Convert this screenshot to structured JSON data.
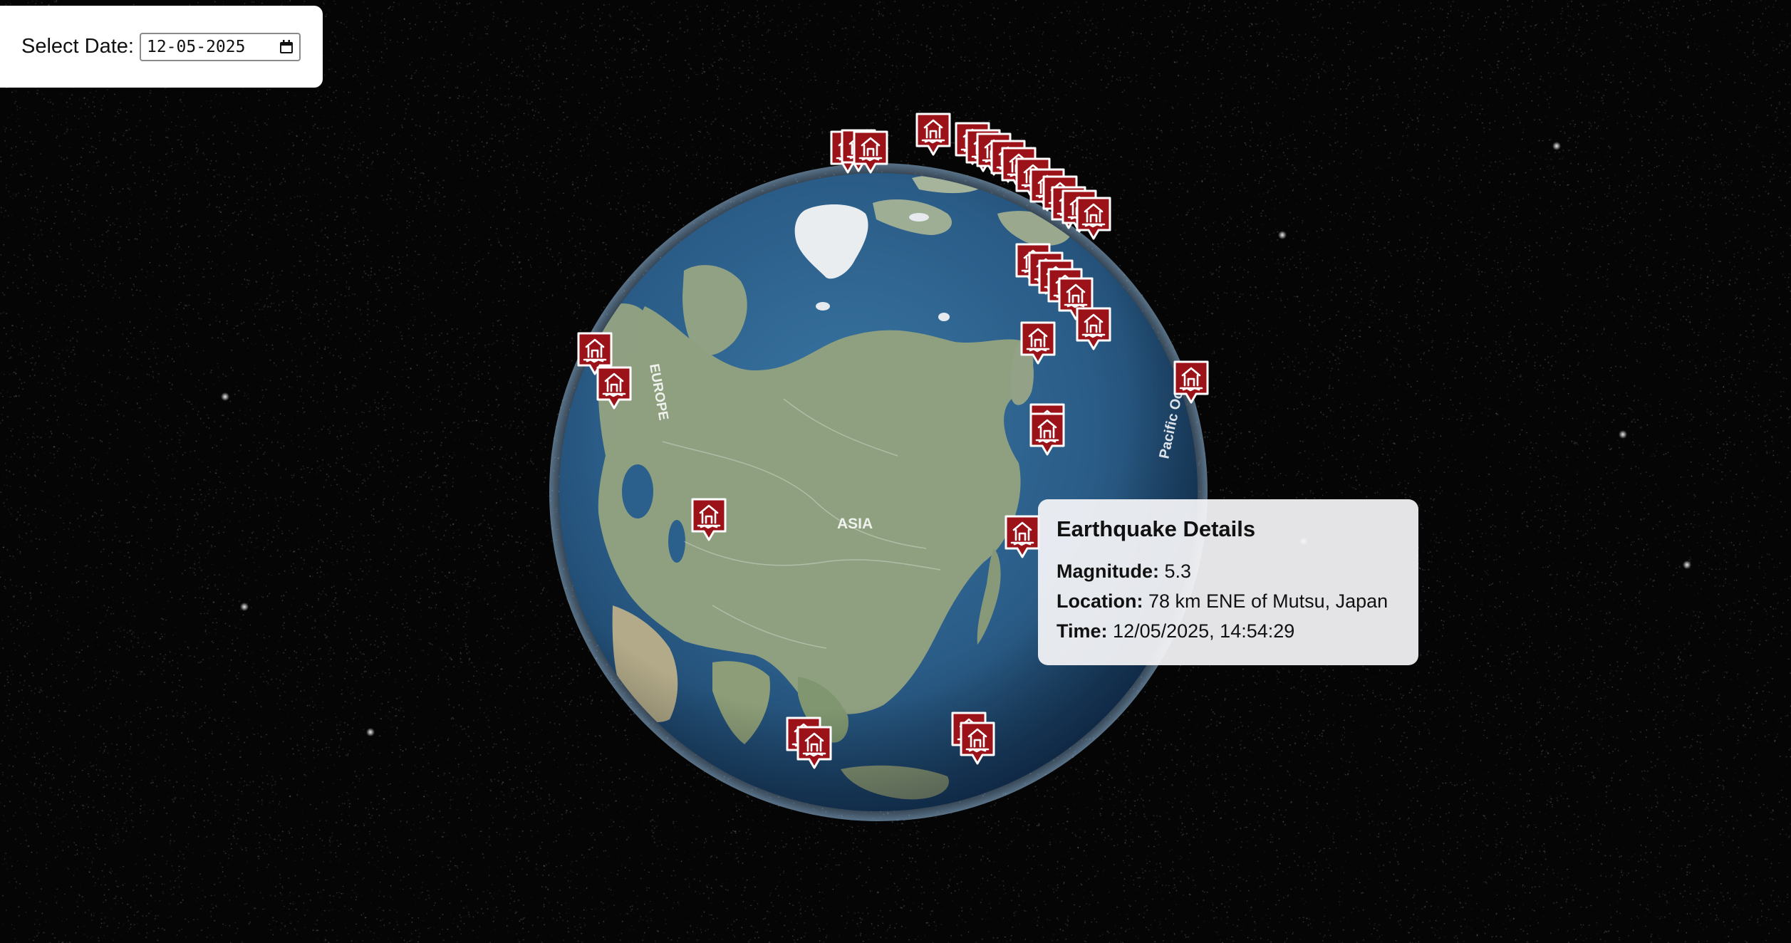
{
  "date_picker": {
    "label": "Select Date:",
    "value": "12-05-2025"
  },
  "globe": {
    "labels": [
      "EUROPE",
      "ASIA",
      "Pacific Ocean"
    ]
  },
  "tooltip": {
    "title": "Earthquake Details",
    "magnitude_label": "Magnitude:",
    "magnitude_value": "5.3",
    "location_label": "Location:",
    "location_value": "78 km ENE of Mutsu, Japan",
    "time_label": "Time:",
    "time_value": "12/05/2025, 14:54:29"
  },
  "marker": {
    "icon": "collapsed-house-icon",
    "color": "#9c1219",
    "count": 30
  },
  "colors": {
    "background": "#050505",
    "ocean": "#2b5f8c",
    "land": "#8fa080",
    "ice": "#e8ecef",
    "marker_red": "#9c1219"
  }
}
